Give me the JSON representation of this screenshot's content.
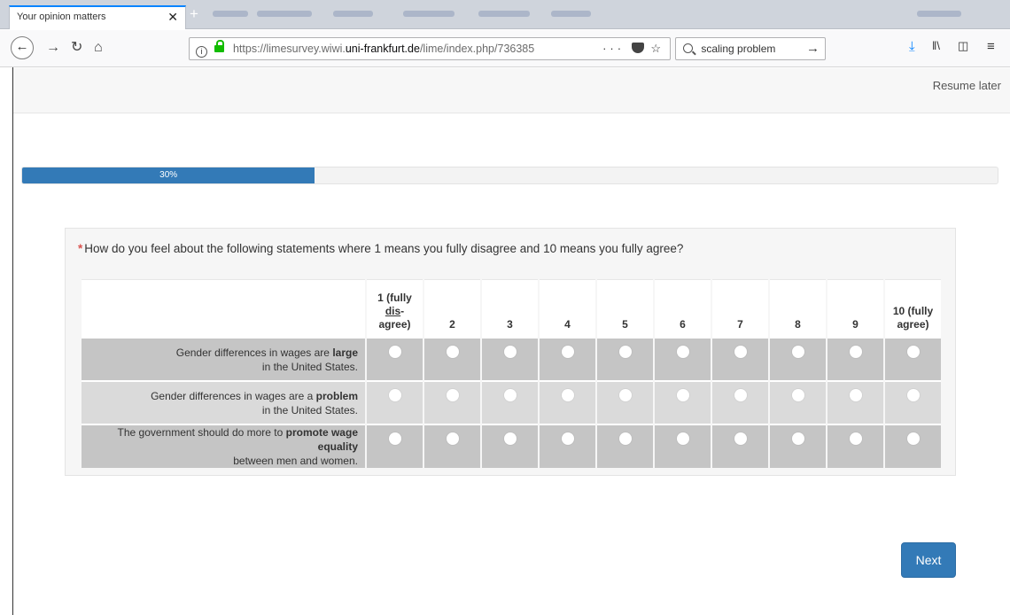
{
  "browser": {
    "tab_title": "Your opinion matters",
    "tab_close": "✕",
    "new_tab": "+",
    "url_prefix": "https://limesurvey.wiwi.",
    "url_host": "uni-frankfurt.de",
    "url_path": "/lime/index.php/736385",
    "url_more": "···",
    "search_value": "scaling problem",
    "search_go": "→",
    "icons": [
      "back-arrow-icon",
      "forward-arrow-icon",
      "reload-icon",
      "home-icon",
      "info-icon",
      "lock-icon",
      "more-icon",
      "pocket-icon",
      "star-icon",
      "search-icon",
      "download-icon",
      "library-icon",
      "sidebar-icon",
      "menu-icon"
    ],
    "accent": "#0a84ff",
    "lock_color": "#12bc00"
  },
  "header": {
    "resume_later": "Resume later"
  },
  "progress": {
    "percent": 30,
    "label": "30%"
  },
  "question": {
    "mandatory_mark": "*",
    "text": "How do you feel about the following statements where 1 means you fully disagree and 10 means you fully agree?",
    "columns": {
      "c1_line1": "1 (fully",
      "c1_line2": "dis",
      "c1_line2b": "-",
      "c1_line3": "agree)",
      "c2": "2",
      "c3": "3",
      "c4": "4",
      "c5": "5",
      "c6": "6",
      "c7": "7",
      "c8": "8",
      "c9": "9",
      "c10_line1": "10 (fully",
      "c10_line2": "agree)"
    },
    "rows": [
      {
        "pre": "Gender differences in wages are ",
        "bold": "large",
        "post": " in the United States."
      },
      {
        "pre": "Gender differences in wages are a ",
        "bold": "problem",
        "post": " in the United States."
      },
      {
        "pre": "The government should do more to ",
        "bold": "promote wage equality",
        "post": " between men and women."
      }
    ]
  },
  "footer": {
    "next_label": "Next"
  },
  "colors": {
    "primary": "#337ab7",
    "row_dark": "#c5c5c5",
    "row_light": "#dadada",
    "required": "#d9534f"
  }
}
